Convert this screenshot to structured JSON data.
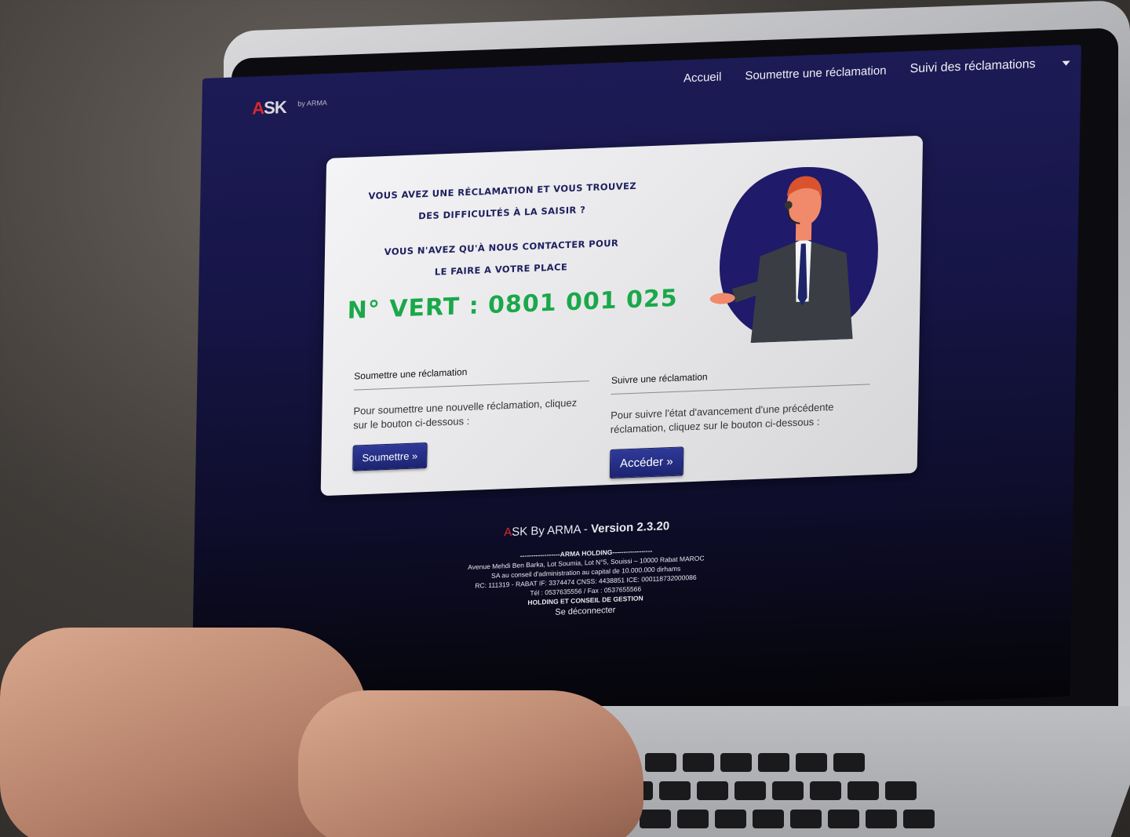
{
  "nav": {
    "logo_text_a": "A",
    "logo_text_rest": "SK",
    "logo_sub": "by ARMA",
    "links": [
      "Accueil",
      "Soumettre une réclamation",
      "Suivi des réclamations"
    ]
  },
  "promo": {
    "line1": "Vous avez une réclamation et vous trouvez",
    "line2": "des difficultés à la saisir ?",
    "line3": "Vous n'avez qu'à nous contacter pour",
    "line4": "le faire a votre place",
    "number": "N° VERT : 0801 001 025"
  },
  "submit_section": {
    "title": "Soumettre une réclamation",
    "text": "Pour soumettre une nouvelle réclamation, cliquez sur le bouton ci-dessous :",
    "button": "Soumettre »"
  },
  "track_section": {
    "title": "Suivre une réclamation",
    "text": "Pour suivre l'état d'avancement d'une précédente réclamation, cliquez sur le bouton ci-dessous :",
    "button": "Accéder »"
  },
  "footer": {
    "version_a": "A",
    "version_mid": "SK By ARMA - ",
    "version_bold": "Version 2.3.20",
    "lines": [
      "------------------ARMA HOLDING------------------",
      "Avenue Mehdi Ben Barka, Lot Soumia, Lot N°5, Souissi – 10000 Rabat MAROC",
      "SA au conseil d'administration au capital de 10.000.000 dirhams",
      "RC: 111319 - RABAT IF: 3374474 CNSS: 4438851 ICE: 000118732000086",
      "Tél : 0537635556 / Fax : 0537655566",
      "HOLDING ET CONSEIL DE GESTION"
    ],
    "logout": "Se déconnecter"
  },
  "colors": {
    "brand_navy": "#1e2060",
    "green_number": "#1aa84a",
    "logo_red": "#d52b2b",
    "button": "#2a3390"
  }
}
